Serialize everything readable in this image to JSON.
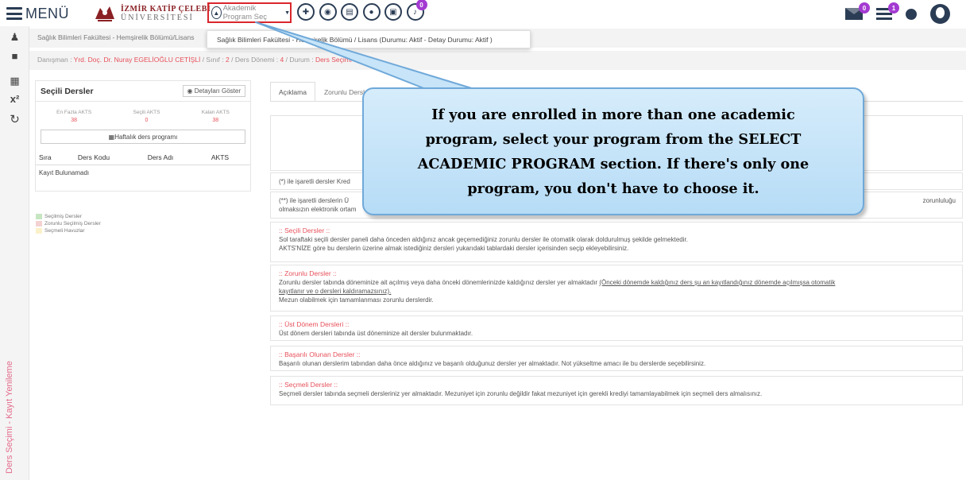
{
  "topbar": {
    "menu_label": "MENÜ",
    "logo_line1": "İZMİR KATİP ÇELEBİ",
    "logo_line2": "ÜNİVERSİTESİ",
    "program_select_label": "Akademik Program Seç",
    "icon_badge": "0",
    "mail_badge": "0",
    "notif_badge": "1"
  },
  "dropdown": {
    "option": "Sağlık Bilimleri Fakültesi - Hemşirelik Bölümü / Lisans (Durumu: Aktif - Detay Durumu: Aktif )"
  },
  "breadcrumb": {
    "line1": "Sağlık Bilimleri Fakültesi - Hemşirelik Bölümü/Lisans",
    "advisor_label": "Danışman : ",
    "advisor_name": "Yrd. Doç. Dr. Nuray EGELİOĞLU CETİŞLİ",
    "class_label": " / Sınıf : ",
    "class_value": "2",
    "term_label": " / Ders Dönemi : ",
    "term_value": "4",
    "status_label": " / Durum : ",
    "status_value": "Ders Seçimi"
  },
  "sidebar": {
    "vertical_label": "Ders Seçimi - Kayıt Yenileme"
  },
  "panel": {
    "title": "Seçili Dersler",
    "details_button": "Detayları Göster",
    "akts": [
      {
        "label": "En Fazla AKTS",
        "value": "38"
      },
      {
        "label": "Seçili AKTS",
        "value": "0"
      },
      {
        "label": "Kalan AKTS",
        "value": "38"
      }
    ],
    "weekly_button": "Haftalık ders programı",
    "columns": [
      "Sıra",
      "Ders Kodu",
      "Ders Adı",
      "AKTS"
    ],
    "empty_row": "Kayıt Bulunamadı"
  },
  "legend": [
    {
      "label": "Seçilmiş Dersler",
      "color": "#c6e6c1"
    },
    {
      "label": "Zorunlu Seçilmiş Dersler",
      "color": "#f5d2d2"
    },
    {
      "label": "Seçmeli Havuzlar",
      "color": "#fbf1c9"
    }
  ],
  "tabs": [
    "Açıklama",
    "Zorunlu Dersler"
  ],
  "content": {
    "note1": "(*) ile işaretli dersler Kred",
    "note2_a": "(**) ile işaretli derslerin Ü",
    "note2_b": "olmaksızın elektronik ortam",
    "note2_tail": "zorunluluğu",
    "selected_title": ":: Seçili Dersler ::",
    "selected_text1": "Sol taraftaki seçili dersler paneli daha önceden aldığınız ancak geçemediğiniz zorunlu dersler ile otomatik olarak doldurulmuş şekilde gelmektedir.",
    "selected_text2": "AKTS'NİZE göre bu derslerin üzerine almak istediğiniz dersleri yukarıdaki tablardaki dersler içerisinden seçip ekleyebilirsiniz.",
    "mandatory_title": ":: Zorunlu Dersler ::",
    "mandatory_text1": "Zorunlu dersler tabında döneminize ait açılmış veya daha önceki dönemlerinizde kaldığınız dersler yer almaktadır ",
    "mandatory_text1_u": "(Önceki dönemde kaldığınız ders şu an kayıtlandığınız dönemde açılmışsa otomatik",
    "mandatory_text2_u": "kayıtlanır ve o dersleri kaldıramazsınız).",
    "mandatory_text3": "Mezun olabilmek için tamamlanması zorunlu derslerdir.",
    "upper_title": ":: Üst Dönem Dersleri ::",
    "upper_text": "Üst dönem dersleri tabında üst döneminize ait dersler bulunmaktadır.",
    "passed_title": ":: Başarılı Olunan Dersler ::",
    "passed_text": "Başarılı olunan derslerim tabından daha önce aldığınız ve başarılı olduğunuz dersler yer almaktadır. Not yükseltme amacı ile bu derslerde seçebilirsiniz.",
    "elective_title": ":: Seçmeli Dersler ::",
    "elective_text": "Seçmeli dersler tabında seçmeli dersleriniz yer almaktadır. Mezuniyet için zorunlu değildir fakat mezuniyet için gerekli krediyi tamamlayabilmek için seçmeli ders almalısınız."
  },
  "callout": {
    "text": "If you are enrolled in more than one academic program, select your program from the SELECT ACADEMIC PROGRAM section. If there's only one program, you don't have to choose it."
  }
}
